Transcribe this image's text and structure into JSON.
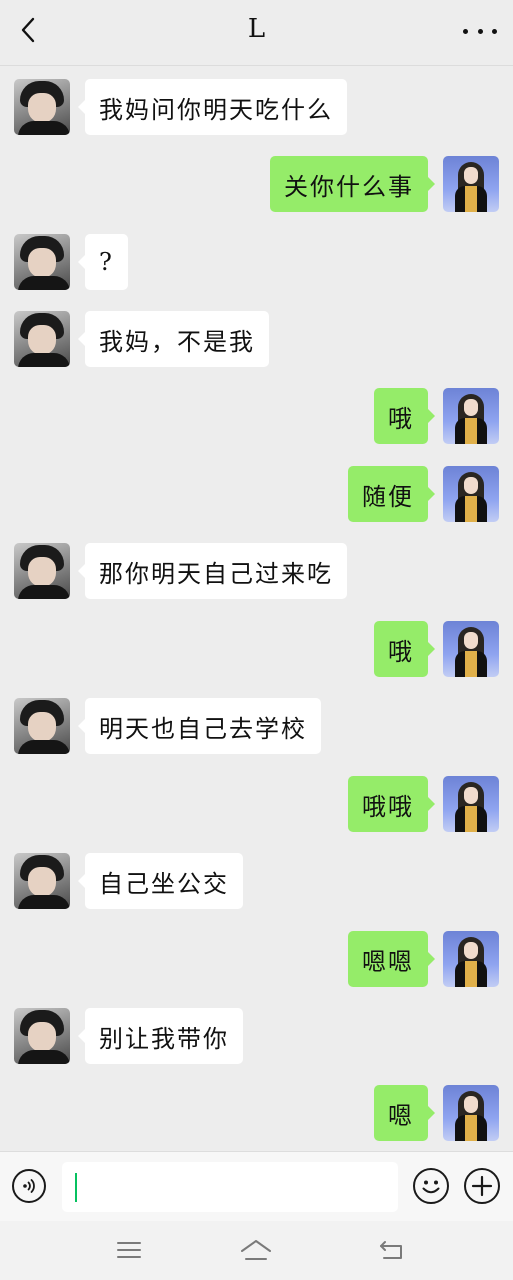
{
  "header": {
    "title": "L",
    "back_icon": "chevron-left-icon",
    "more_icon": "more-dots-icon"
  },
  "messages": [
    {
      "side": "left",
      "text": "我妈问你明天吃什么"
    },
    {
      "side": "right",
      "text": "关你什么事"
    },
    {
      "side": "left",
      "text": "?"
    },
    {
      "side": "left",
      "text": "我妈，不是我"
    },
    {
      "side": "right",
      "text": "哦"
    },
    {
      "side": "right",
      "text": "随便"
    },
    {
      "side": "left",
      "text": "那你明天自己过来吃"
    },
    {
      "side": "right",
      "text": "哦"
    },
    {
      "side": "left",
      "text": "明天也自己去学校"
    },
    {
      "side": "right",
      "text": "哦哦"
    },
    {
      "side": "left",
      "text": "自己坐公交"
    },
    {
      "side": "right",
      "text": "嗯嗯"
    },
    {
      "side": "left",
      "text": "别让我带你"
    },
    {
      "side": "right",
      "text": "嗯"
    }
  ],
  "input_bar": {
    "value": "",
    "voice_icon": "voice-icon",
    "emoji_icon": "emoji-icon",
    "plus_icon": "plus-icon"
  },
  "nav_bar": {
    "menu_icon": "menu-icon",
    "home_icon": "home-icon",
    "back_icon": "back-arrow-icon"
  },
  "colors": {
    "background": "#ededed",
    "my_bubble": "#95ec69",
    "their_bubble": "#ffffff",
    "caret": "#07c160"
  }
}
